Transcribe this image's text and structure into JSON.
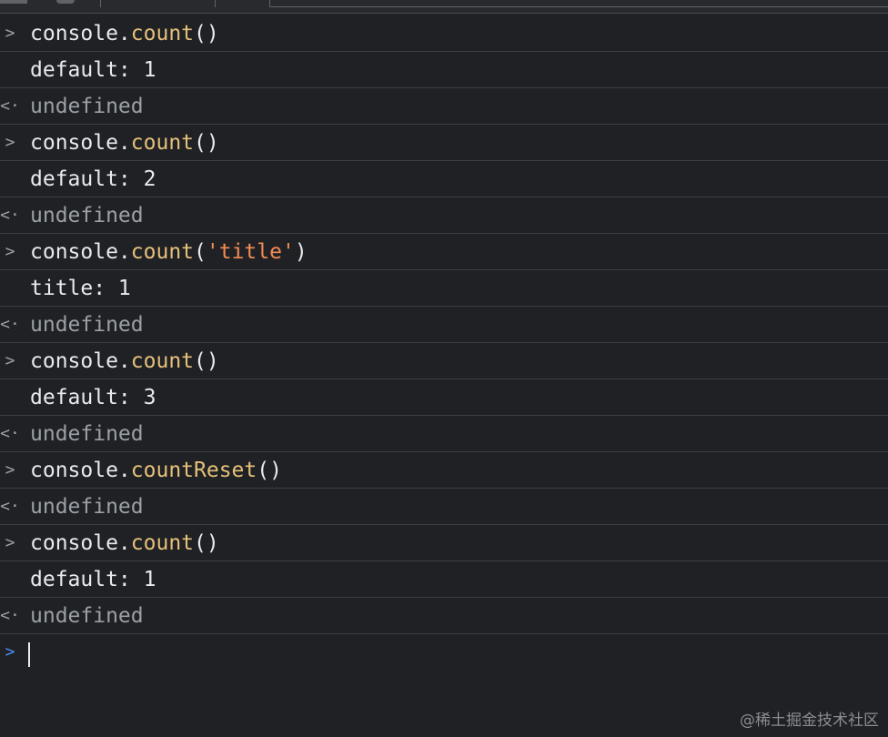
{
  "rows": [
    {
      "kind": "input",
      "gutter": ">",
      "obj": "console.",
      "fn": "count",
      "open": "(",
      "arg": "",
      "close": ")"
    },
    {
      "kind": "output",
      "text": "default: 1"
    },
    {
      "kind": "result",
      "gutter": "<·",
      "text": "undefined"
    },
    {
      "kind": "input",
      "gutter": ">",
      "obj": "console.",
      "fn": "count",
      "open": "(",
      "arg": "",
      "close": ")"
    },
    {
      "kind": "output",
      "text": "default: 2"
    },
    {
      "kind": "result",
      "gutter": "<·",
      "text": "undefined"
    },
    {
      "kind": "input",
      "gutter": ">",
      "obj": "console.",
      "fn": "count",
      "open": "(",
      "arg": "'title'",
      "close": ")"
    },
    {
      "kind": "output",
      "text": "title: 1"
    },
    {
      "kind": "result",
      "gutter": "<·",
      "text": "undefined"
    },
    {
      "kind": "input",
      "gutter": ">",
      "obj": "console.",
      "fn": "count",
      "open": "(",
      "arg": "",
      "close": ")"
    },
    {
      "kind": "output",
      "text": "default: 3"
    },
    {
      "kind": "result",
      "gutter": "<·",
      "text": "undefined"
    },
    {
      "kind": "input",
      "gutter": ">",
      "obj": "console.",
      "fn": "countReset",
      "open": "(",
      "arg": "",
      "close": ")"
    },
    {
      "kind": "result",
      "gutter": "<·",
      "text": "undefined"
    },
    {
      "kind": "input",
      "gutter": ">",
      "obj": "console.",
      "fn": "count",
      "open": "(",
      "arg": "",
      "close": ")"
    },
    {
      "kind": "output",
      "text": "default: 1"
    },
    {
      "kind": "result",
      "gutter": "<·",
      "text": "undefined"
    }
  ],
  "prompt": {
    "gutter": ">",
    "value": ""
  },
  "watermark": "@稀土掘金技术社区",
  "colors": {
    "background": "#202124",
    "function": "#e5c07b",
    "string": "#f28b54",
    "result": "#9aa0a6",
    "prompt": "#4a8cf7"
  }
}
